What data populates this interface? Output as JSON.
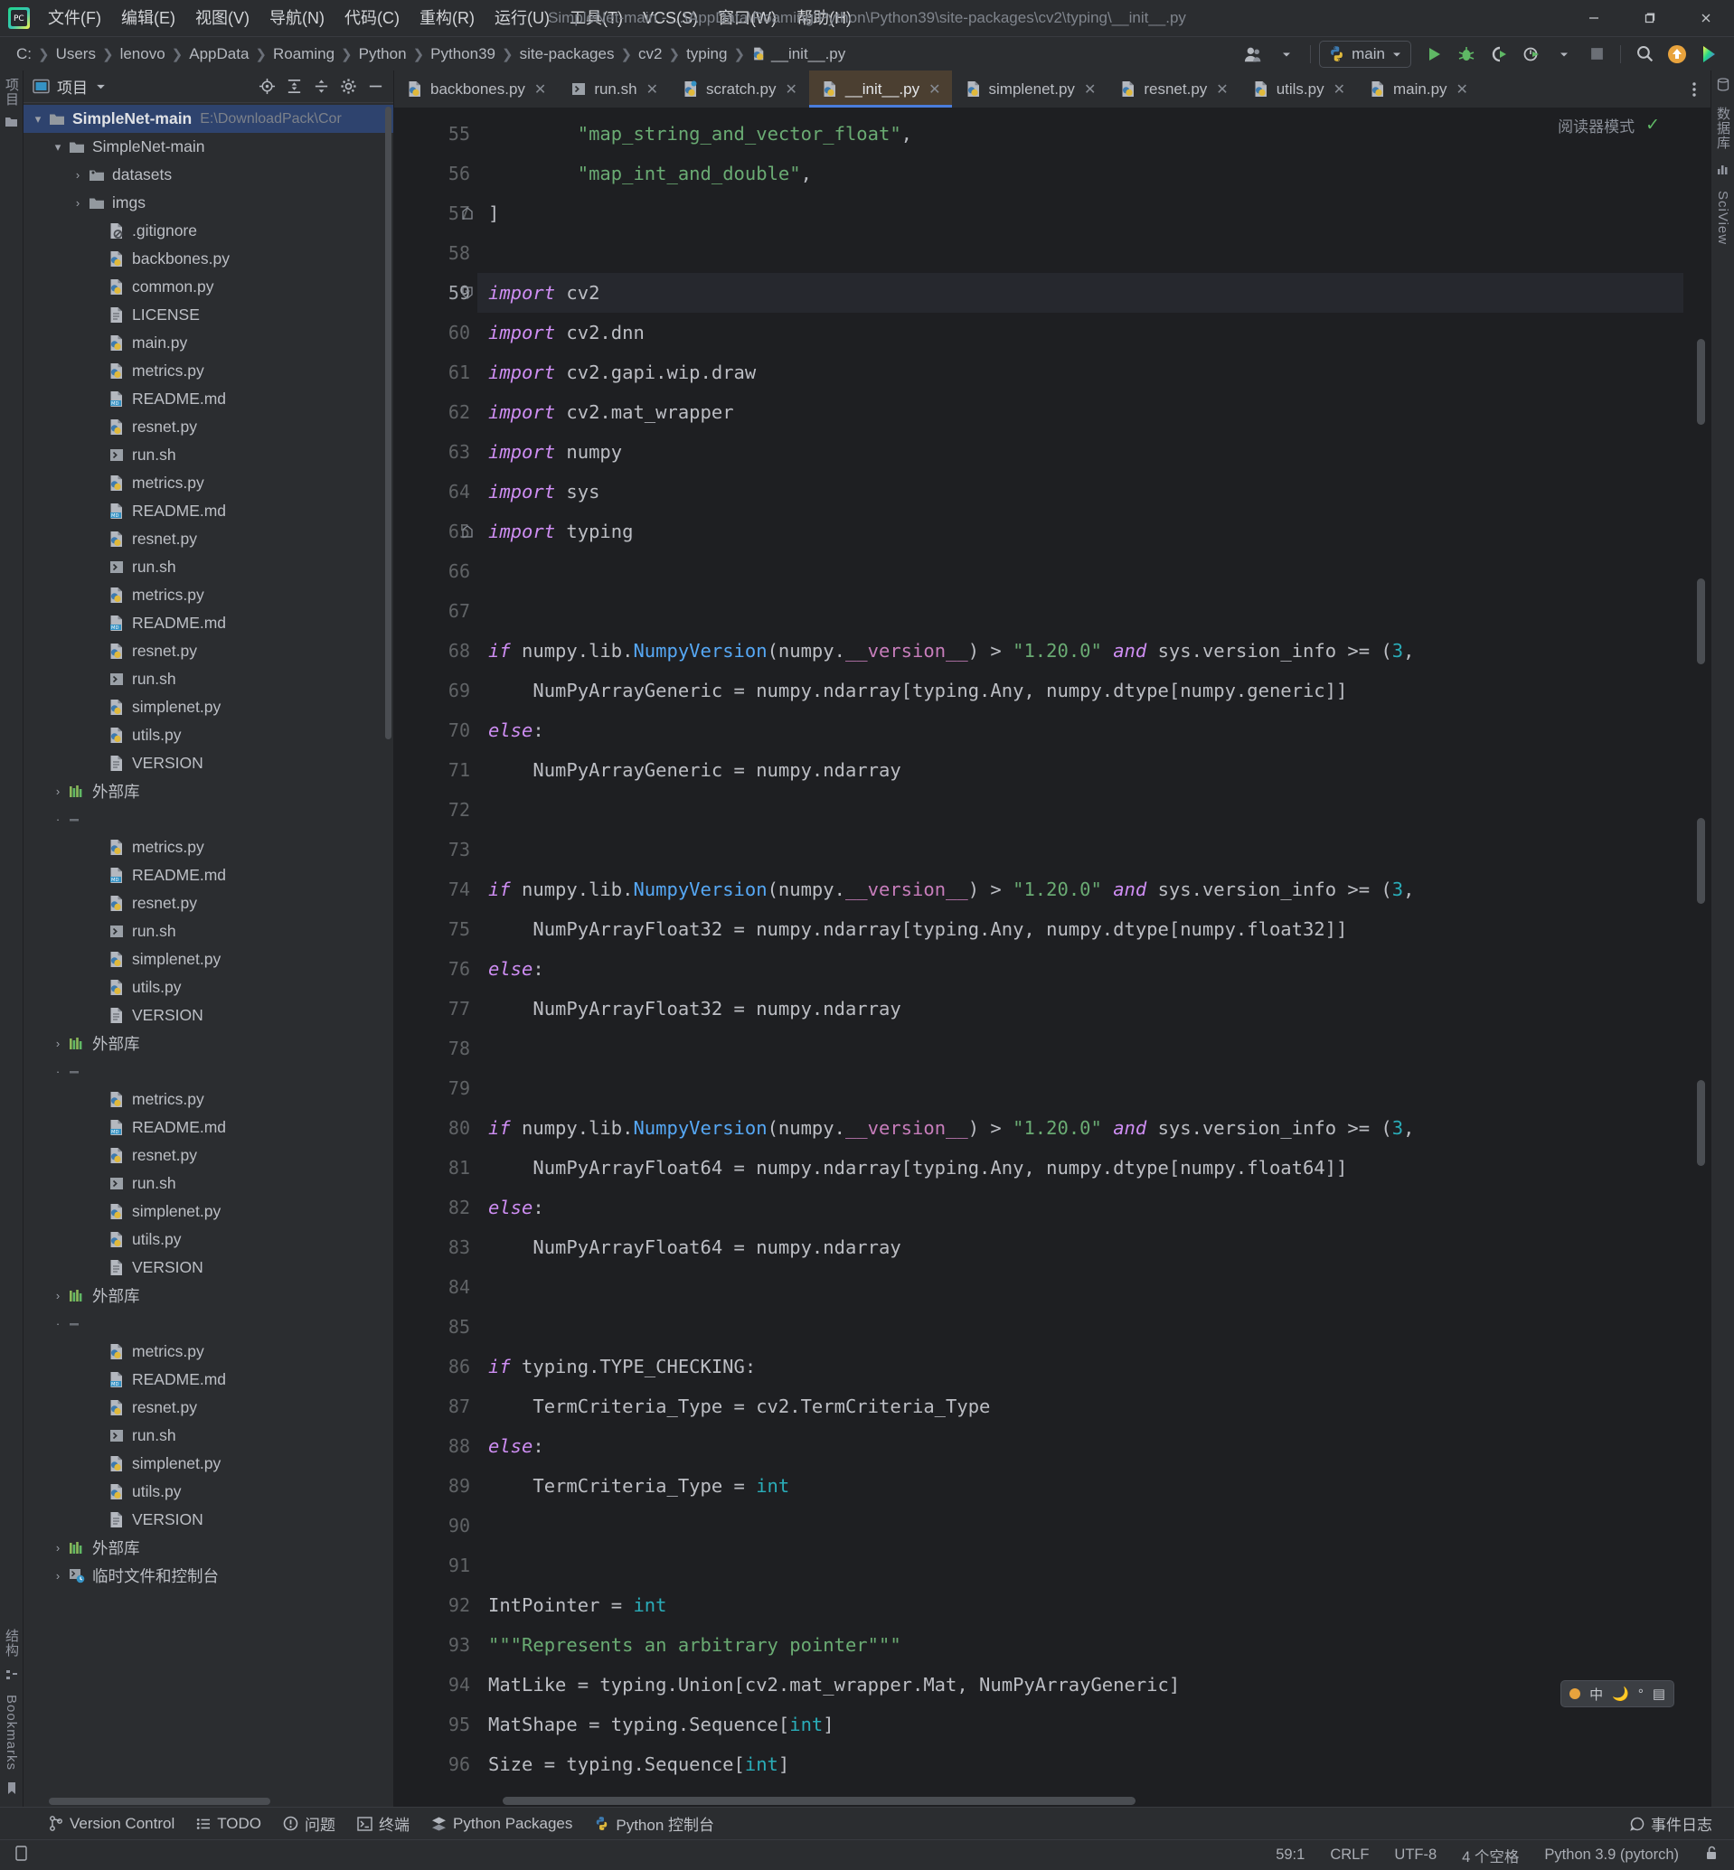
{
  "window": {
    "title": "SimpleNet-main - ...\\AppData\\Roaming\\Python\\Python39\\site-packages\\cv2\\typing\\__init__.py",
    "minimize": "—",
    "maximize": "❐",
    "close": "✕"
  },
  "menubar": [
    {
      "label": "文件(F)"
    },
    {
      "label": "编辑(E)"
    },
    {
      "label": "视图(V)"
    },
    {
      "label": "导航(N)"
    },
    {
      "label": "代码(C)"
    },
    {
      "label": "重构(R)"
    },
    {
      "label": "运行(U)"
    },
    {
      "label": "工具(T)"
    },
    {
      "label": "VCS(S)"
    },
    {
      "label": "窗口(W)"
    },
    {
      "label": "帮助(H)"
    }
  ],
  "breadcrumbs": [
    {
      "label": "C:"
    },
    {
      "label": "Users"
    },
    {
      "label": "lenovo"
    },
    {
      "label": "AppData"
    },
    {
      "label": "Roaming"
    },
    {
      "label": "Python"
    },
    {
      "label": "Python39"
    },
    {
      "label": "site-packages"
    },
    {
      "label": "cv2"
    },
    {
      "label": "typing"
    },
    {
      "label": "__init__.py"
    }
  ],
  "toolbar": {
    "run_config": "main",
    "icons": [
      "user-account-icon",
      "run-icon",
      "debug-icon",
      "coverage-icon",
      "profile-icon",
      "stop-icon",
      "search-everywhere-icon",
      "update-project-icon",
      "ai-assistant-icon"
    ]
  },
  "project_panel": {
    "title": "项目",
    "actions": [
      "locate-icon",
      "expand-all-icon",
      "collapse-all-icon",
      "settings-icon",
      "hide-icon"
    ],
    "tree": [
      {
        "indent": 0,
        "arrow": "▾",
        "icon": "folder",
        "label": "SimpleNet-main",
        "path": "E:\\DownloadPack\\Cor",
        "bold": true,
        "selected": true
      },
      {
        "indent": 1,
        "arrow": "▾",
        "icon": "folder",
        "label": "SimpleNet-main",
        "bold": false
      },
      {
        "indent": 2,
        "arrow": "›",
        "icon": "folder-src",
        "label": "datasets"
      },
      {
        "indent": 2,
        "arrow": "›",
        "icon": "folder",
        "label": "imgs"
      },
      {
        "indent": 3,
        "arrow": "",
        "icon": "gitignore",
        "label": ".gitignore"
      },
      {
        "indent": 3,
        "arrow": "",
        "icon": "python",
        "label": "backbones.py"
      },
      {
        "indent": 3,
        "arrow": "",
        "icon": "python",
        "label": "common.py"
      },
      {
        "indent": 3,
        "arrow": "",
        "icon": "text",
        "label": "LICENSE"
      },
      {
        "indent": 3,
        "arrow": "",
        "icon": "python",
        "label": "main.py"
      },
      {
        "indent": 3,
        "arrow": "",
        "icon": "python",
        "label": "metrics.py"
      },
      {
        "indent": 3,
        "arrow": "",
        "icon": "md",
        "label": "README.md"
      },
      {
        "indent": 3,
        "arrow": "",
        "icon": "python",
        "label": "resnet.py"
      },
      {
        "indent": 3,
        "arrow": "",
        "icon": "sh",
        "label": "run.sh"
      },
      {
        "indent": 3,
        "arrow": "",
        "icon": "python",
        "label": "metrics.py"
      },
      {
        "indent": 3,
        "arrow": "",
        "icon": "md",
        "label": "README.md"
      },
      {
        "indent": 3,
        "arrow": "",
        "icon": "python",
        "label": "resnet.py"
      },
      {
        "indent": 3,
        "arrow": "",
        "icon": "sh",
        "label": "run.sh"
      },
      {
        "indent": 3,
        "arrow": "",
        "icon": "python",
        "label": "metrics.py"
      },
      {
        "indent": 3,
        "arrow": "",
        "icon": "md",
        "label": "README.md"
      },
      {
        "indent": 3,
        "arrow": "",
        "icon": "python",
        "label": "resnet.py"
      },
      {
        "indent": 3,
        "arrow": "",
        "icon": "sh",
        "label": "run.sh"
      },
      {
        "indent": 3,
        "arrow": "",
        "icon": "python",
        "label": "simplenet.py"
      },
      {
        "indent": 3,
        "arrow": "",
        "icon": "python",
        "label": "utils.py"
      },
      {
        "indent": 3,
        "arrow": "",
        "icon": "text",
        "label": "VERSION"
      },
      {
        "indent": 1,
        "arrow": "›",
        "icon": "library",
        "label": "外部库"
      },
      {
        "indent": 1,
        "arrow": "·",
        "icon": "ghost",
        "label": ""
      },
      {
        "indent": 3,
        "arrow": "",
        "icon": "python",
        "label": "metrics.py"
      },
      {
        "indent": 3,
        "arrow": "",
        "icon": "md",
        "label": "README.md"
      },
      {
        "indent": 3,
        "arrow": "",
        "icon": "python",
        "label": "resnet.py"
      },
      {
        "indent": 3,
        "arrow": "",
        "icon": "sh",
        "label": "run.sh"
      },
      {
        "indent": 3,
        "arrow": "",
        "icon": "python",
        "label": "simplenet.py"
      },
      {
        "indent": 3,
        "arrow": "",
        "icon": "python",
        "label": "utils.py"
      },
      {
        "indent": 3,
        "arrow": "",
        "icon": "text",
        "label": "VERSION"
      },
      {
        "indent": 1,
        "arrow": "›",
        "icon": "library",
        "label": "外部库"
      },
      {
        "indent": 1,
        "arrow": "·",
        "icon": "ghost",
        "label": ""
      },
      {
        "indent": 3,
        "arrow": "",
        "icon": "python",
        "label": "metrics.py"
      },
      {
        "indent": 3,
        "arrow": "",
        "icon": "md",
        "label": "README.md"
      },
      {
        "indent": 3,
        "arrow": "",
        "icon": "python",
        "label": "resnet.py"
      },
      {
        "indent": 3,
        "arrow": "",
        "icon": "sh",
        "label": "run.sh"
      },
      {
        "indent": 3,
        "arrow": "",
        "icon": "python",
        "label": "simplenet.py"
      },
      {
        "indent": 3,
        "arrow": "",
        "icon": "python",
        "label": "utils.py"
      },
      {
        "indent": 3,
        "arrow": "",
        "icon": "text",
        "label": "VERSION"
      },
      {
        "indent": 1,
        "arrow": "›",
        "icon": "library",
        "label": "外部库"
      },
      {
        "indent": 1,
        "arrow": "·",
        "icon": "ghost",
        "label": ""
      },
      {
        "indent": 3,
        "arrow": "",
        "icon": "python",
        "label": "metrics.py"
      },
      {
        "indent": 3,
        "arrow": "",
        "icon": "md",
        "label": "README.md"
      },
      {
        "indent": 3,
        "arrow": "",
        "icon": "python",
        "label": "resnet.py"
      },
      {
        "indent": 3,
        "arrow": "",
        "icon": "sh",
        "label": "run.sh"
      },
      {
        "indent": 3,
        "arrow": "",
        "icon": "python",
        "label": "simplenet.py"
      },
      {
        "indent": 3,
        "arrow": "",
        "icon": "python",
        "label": "utils.py"
      },
      {
        "indent": 3,
        "arrow": "",
        "icon": "text",
        "label": "VERSION"
      },
      {
        "indent": 1,
        "arrow": "›",
        "icon": "library",
        "label": "外部库"
      },
      {
        "indent": 1,
        "arrow": "›",
        "icon": "scratch",
        "label": "临时文件和控制台"
      }
    ]
  },
  "editor_tabs": [
    {
      "label": "backbones.py",
      "icon": "python",
      "active": false
    },
    {
      "label": "run.sh",
      "icon": "sh",
      "active": false
    },
    {
      "label": "scratch.py",
      "icon": "python-scratch",
      "active": false
    },
    {
      "label": "__init__.py",
      "icon": "python",
      "active": true
    },
    {
      "label": "simplenet.py",
      "icon": "python",
      "active": false
    },
    {
      "label": "resnet.py",
      "icon": "python",
      "active": false
    },
    {
      "label": "utils.py",
      "icon": "python",
      "active": false
    },
    {
      "label": "main.py",
      "icon": "python",
      "active": false
    }
  ],
  "editor": {
    "reader_mode": "阅读器模式",
    "first_line": 55,
    "lines": [
      {
        "n": 55,
        "indent": 2,
        "html": "<span class=\"s\">\"map_string_and_vector_float\"</span>,"
      },
      {
        "n": 56,
        "indent": 2,
        "html": "<span class=\"s\">\"map_int_and_double\"</span>,"
      },
      {
        "n": 57,
        "indent": 0,
        "html": "]",
        "fold": "end"
      },
      {
        "n": 58,
        "indent": 0,
        "html": ""
      },
      {
        "n": 59,
        "indent": 0,
        "html": "<span class=\"k\">import</span> cv2",
        "current": true,
        "fold": "start"
      },
      {
        "n": 60,
        "indent": 0,
        "html": "<span class=\"k\">import</span> cv2.dnn"
      },
      {
        "n": 61,
        "indent": 0,
        "html": "<span class=\"k\">import</span> cv2.gapi.wip.draw"
      },
      {
        "n": 62,
        "indent": 0,
        "html": "<span class=\"k\">import</span> cv2.mat_wrapper"
      },
      {
        "n": 63,
        "indent": 0,
        "html": "<span class=\"k\">import</span> numpy"
      },
      {
        "n": 64,
        "indent": 0,
        "html": "<span class=\"k\">import</span> sys"
      },
      {
        "n": 65,
        "indent": 0,
        "html": "<span class=\"k\">import</span> typing",
        "fold": "end"
      },
      {
        "n": 66,
        "indent": 0,
        "html": ""
      },
      {
        "n": 67,
        "indent": 0,
        "html": ""
      },
      {
        "n": 68,
        "indent": 0,
        "html": "<span class=\"k\">if</span> numpy.lib.<span class=\"cl\">NumpyVersion</span>(numpy.<span class=\"df\">__version__</span>) &gt; <span class=\"s\">\"1.20.0\"</span> <span class=\"k\">and</span> sys.version_info &gt;= (<span class=\"n\">3</span>,"
      },
      {
        "n": 69,
        "indent": 1,
        "html": "NumPyArrayGeneric = numpy.ndarray[typing.Any, numpy.dtype[numpy.generic]]"
      },
      {
        "n": 70,
        "indent": 0,
        "html": "<span class=\"k\">else</span>:"
      },
      {
        "n": 71,
        "indent": 1,
        "html": "NumPyArrayGeneric = numpy.ndarray"
      },
      {
        "n": 72,
        "indent": 0,
        "html": ""
      },
      {
        "n": 73,
        "indent": 0,
        "html": ""
      },
      {
        "n": 74,
        "indent": 0,
        "html": "<span class=\"k\">if</span> numpy.lib.<span class=\"cl\">NumpyVersion</span>(numpy.<span class=\"df\">__version__</span>) &gt; <span class=\"s\">\"1.20.0\"</span> <span class=\"k\">and</span> sys.version_info &gt;= (<span class=\"n\">3</span>,"
      },
      {
        "n": 75,
        "indent": 1,
        "html": "NumPyArrayFloat32 = numpy.ndarray[typing.Any, numpy.dtype[numpy.float32]]"
      },
      {
        "n": 76,
        "indent": 0,
        "html": "<span class=\"k\">else</span>:"
      },
      {
        "n": 77,
        "indent": 1,
        "html": "NumPyArrayFloat32 = numpy.ndarray"
      },
      {
        "n": 78,
        "indent": 0,
        "html": ""
      },
      {
        "n": 79,
        "indent": 0,
        "html": ""
      },
      {
        "n": 80,
        "indent": 0,
        "html": "<span class=\"k\">if</span> numpy.lib.<span class=\"cl\">NumpyVersion</span>(numpy.<span class=\"df\">__version__</span>) &gt; <span class=\"s\">\"1.20.0\"</span> <span class=\"k\">and</span> sys.version_info &gt;= (<span class=\"n\">3</span>,"
      },
      {
        "n": 81,
        "indent": 1,
        "html": "NumPyArrayFloat64 = numpy.ndarray[typing.Any, numpy.dtype[numpy.float64]]"
      },
      {
        "n": 82,
        "indent": 0,
        "html": "<span class=\"k\">else</span>:"
      },
      {
        "n": 83,
        "indent": 1,
        "html": "NumPyArrayFloat64 = numpy.ndarray"
      },
      {
        "n": 84,
        "indent": 0,
        "html": ""
      },
      {
        "n": 85,
        "indent": 0,
        "html": ""
      },
      {
        "n": 86,
        "indent": 0,
        "html": "<span class=\"k\">if</span> typing.TYPE_CHECKING:"
      },
      {
        "n": 87,
        "indent": 1,
        "html": "TermCriteria_Type = cv2.TermCriteria_Type"
      },
      {
        "n": 88,
        "indent": 0,
        "html": "<span class=\"k\">else</span>:"
      },
      {
        "n": 89,
        "indent": 1,
        "html": "TermCriteria_Type = <span class=\"n\">int</span>"
      },
      {
        "n": 90,
        "indent": 0,
        "html": ""
      },
      {
        "n": 91,
        "indent": 0,
        "html": ""
      },
      {
        "n": 92,
        "indent": 0,
        "html": "IntPointer = <span class=\"n\">int</span>"
      },
      {
        "n": 93,
        "indent": 0,
        "html": "<span class=\"s\">\"\"\"Represents an arbitrary pointer\"\"\"</span>"
      },
      {
        "n": 94,
        "indent": 0,
        "html": "MatLike = typing.Union[cv2.mat_wrapper.Mat, NumPyArrayGeneric]"
      },
      {
        "n": 95,
        "indent": 0,
        "html": "MatShape = typing.Sequence[<span class=\"n\">int</span>]"
      },
      {
        "n": 96,
        "indent": 0,
        "html": "Size = typing.Sequence[<span class=\"n\">int</span>]"
      }
    ],
    "ime": {
      "lang": "中",
      "items": [
        "ime-dot",
        "中",
        "moon-icon",
        "degree-icon",
        "menu-icon"
      ]
    }
  },
  "right_rail": [
    {
      "label": "数据库",
      "name": "database-tool"
    },
    {
      "label": "SciView",
      "name": "sciview-tool"
    }
  ],
  "left_rail": {
    "top_label": "项目",
    "bottom_labels": [
      "结构",
      "Bookmarks"
    ]
  },
  "tool_windows": [
    {
      "label": "Version Control",
      "icon": "vcs-icon"
    },
    {
      "label": "TODO",
      "icon": "todo-icon"
    },
    {
      "label": "问题",
      "icon": "problems-icon"
    },
    {
      "label": "终端",
      "icon": "terminal-icon"
    },
    {
      "label": "Python Packages",
      "icon": "packages-icon"
    },
    {
      "label": "Python 控制台",
      "icon": "python-console-icon"
    }
  ],
  "status_bar": {
    "event_log": "事件日志",
    "caret": "59:1",
    "line_sep": "CRLF",
    "encoding": "UTF-8",
    "indent": "4 个空格",
    "interpreter": "Python 3.9 (pytorch)"
  },
  "colors": {
    "accent": "#4a7ddb",
    "tab_active_bg": "#4b3f31",
    "run_green": "#5fb865",
    "string_green": "#6aab73",
    "keyword_purple": "#cf8ef4"
  }
}
